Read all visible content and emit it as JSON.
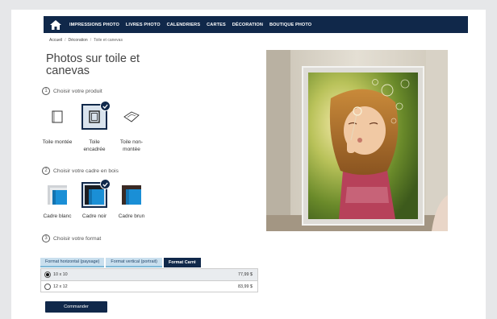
{
  "nav": {
    "items": [
      "IMPRESSIONS PHOTO",
      "LIVRES PHOTO",
      "CALENDRIERS",
      "CARTES",
      "DÉCORATION",
      "BOUTIQUE PHOTO"
    ]
  },
  "breadcrumb": {
    "home": "Accueil",
    "section": "Décoration",
    "current": "Toile et canevas"
  },
  "page_title": "Photos sur toile et canevas",
  "steps": {
    "s1": {
      "num": "1",
      "label": "Choisir votre produit"
    },
    "s2": {
      "num": "2",
      "label": "Choisir votre cadre en bois"
    },
    "s3": {
      "num": "3",
      "label": "Choisir votre format"
    }
  },
  "products": [
    {
      "label": "Toile montée",
      "icon": "canvas-mounted-icon",
      "selected": false
    },
    {
      "label": "Toile encadrée",
      "icon": "canvas-framed-icon",
      "selected": true
    },
    {
      "label": "Toile non-montée",
      "icon": "canvas-unmounted-icon",
      "selected": false
    }
  ],
  "frames": [
    {
      "label": "Cadre blanc",
      "icon": "frame-white-icon",
      "selected": false
    },
    {
      "label": "Cadre noir",
      "icon": "frame-black-icon",
      "selected": true
    },
    {
      "label": "Cadre brun",
      "icon": "frame-brown-icon",
      "selected": false
    }
  ],
  "format_tabs": [
    {
      "label": "Format horizontal (paysage)",
      "active": false
    },
    {
      "label": "Format vertical (portrait)",
      "active": false
    },
    {
      "label": "Format Carré",
      "active": true
    }
  ],
  "sizes": [
    {
      "label": "10 x 10",
      "price": "77,99 $",
      "selected": true
    },
    {
      "label": "12 x 12",
      "price": "83,99 $",
      "selected": false
    }
  ],
  "order_button": "Commander",
  "colors": {
    "navy": "#10284a",
    "tab_light": "#c9dfee",
    "accent_blue": "#1a8fd6"
  }
}
